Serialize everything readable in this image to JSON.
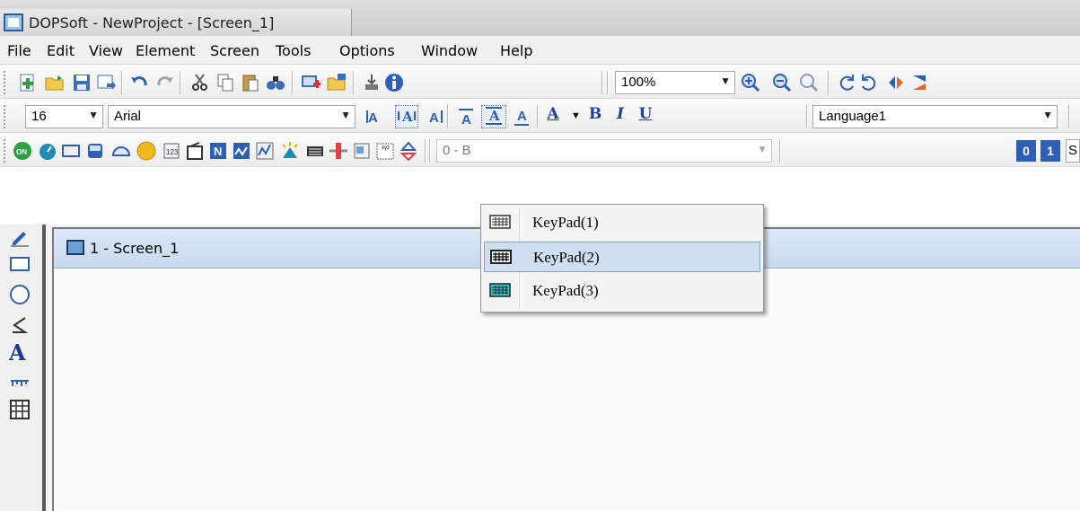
{
  "window": {
    "title": "DOPSoft - NewProject - [Screen_1]"
  },
  "menu": [
    "File",
    "Edit",
    "View",
    "Element",
    "Screen",
    "Tools",
    "Options",
    "Window",
    "Help"
  ],
  "toolbar1": {
    "zoom": "100%"
  },
  "toolbar2": {
    "font_size": "16",
    "font_name": "Arial",
    "language": "Language1"
  },
  "toolbar3": {
    "address": "0 - B",
    "bit_off": "0",
    "bit_on": "1",
    "cut_label": "S"
  },
  "document": {
    "tab_title": "1 - Screen_1"
  },
  "keypad_menu": {
    "items": [
      {
        "label": "KeyPad(1)",
        "selected": false
      },
      {
        "label": "KeyPad(2)",
        "selected": true
      },
      {
        "label": "KeyPad(3)",
        "selected": false
      }
    ]
  },
  "format_labels": {
    "text_color": "A",
    "bold": "B",
    "italic": "I",
    "underline": "U"
  },
  "sidebar": {
    "text_tool": "A"
  },
  "colors": {
    "accent": "#2d5fb5",
    "highlight": "#cfdff2",
    "title_bg": "#d6d6d6"
  }
}
